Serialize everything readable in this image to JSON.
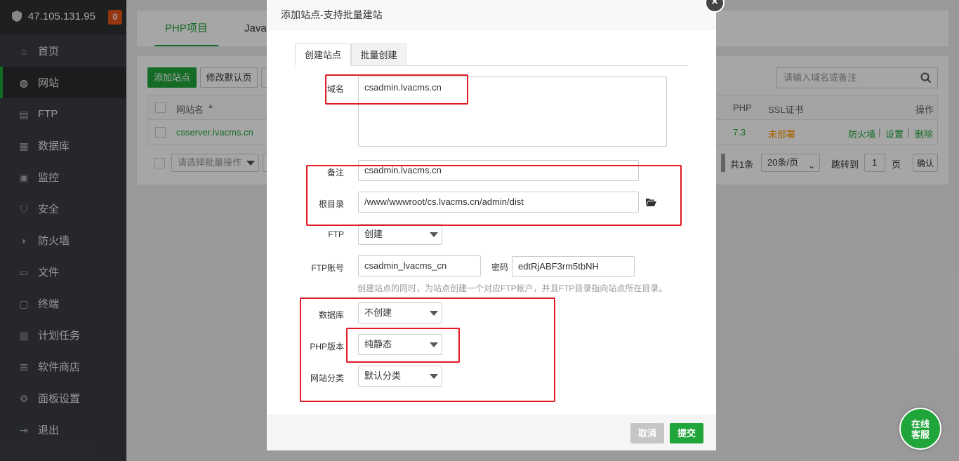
{
  "sidebar": {
    "ip": "47.105.131.95",
    "badge": "0",
    "items": [
      {
        "label": "首页",
        "icon": "home-icon"
      },
      {
        "label": "网站",
        "icon": "globe-icon"
      },
      {
        "label": "FTP",
        "icon": "ftp-icon"
      },
      {
        "label": "数据库",
        "icon": "database-icon"
      },
      {
        "label": "监控",
        "icon": "monitor-icon"
      },
      {
        "label": "安全",
        "icon": "shield-icon"
      },
      {
        "label": "防火墙",
        "icon": "firewall-icon"
      },
      {
        "label": "文件",
        "icon": "folder-icon"
      },
      {
        "label": "终端",
        "icon": "terminal-icon"
      },
      {
        "label": "计划任务",
        "icon": "calendar-icon"
      },
      {
        "label": "软件商店",
        "icon": "apps-icon"
      },
      {
        "label": "面板设置",
        "icon": "gear-icon"
      },
      {
        "label": "退出",
        "icon": "logout-icon"
      }
    ]
  },
  "page_tabs": [
    "PHP项目",
    "Java"
  ],
  "toolbar": {
    "add_site": "添加站点",
    "modify_default": "修改默认页",
    "search_placeholder": "请输入域名或备注"
  },
  "table": {
    "headers": {
      "name": "网站名",
      "php": "PHP",
      "ssl": "SSL证书",
      "ops": "操作"
    },
    "rows": [
      {
        "name": "csserver.lvacms.cn",
        "php": "7.3",
        "ssl": "未部署",
        "firewall": "防火墙",
        "settings": "设置",
        "delete": "删除"
      }
    ],
    "batch_placeholder": "请选择批量操作",
    "total": "共1条",
    "per_page": "20条/页",
    "goto": "跳转到",
    "page": "1",
    "page_unit": "页",
    "confirm": "确认"
  },
  "modal": {
    "title": "添加站点-支持批量建站",
    "tabs": [
      "创建站点",
      "批量创建"
    ],
    "domain_label": "域名",
    "domain_value": "csadmin.lvacms.cn",
    "remark_label": "备注",
    "remark_value": "csadmin.lvacms.cn",
    "root_label": "根目录",
    "root_value": "/www/wwwroot/cs.lvacms.cn/admin/dist",
    "ftp_label": "FTP",
    "ftp_value": "创建",
    "ftp_account_label": "FTP账号",
    "ftp_account_value": "csadmin_lvacms_cn",
    "password_label": "密码",
    "password_value": "edtRjABF3rm5tbNH",
    "ftp_hint": "创建站点的同时，为站点创建一个对应FTP帐户，并且FTP目录指向站点所在目录。",
    "db_label": "数据库",
    "db_value": "不创建",
    "php_label": "PHP版本",
    "php_value": "纯静态",
    "category_label": "网站分类",
    "category_value": "默认分类",
    "cancel": "取消",
    "submit": "提交"
  },
  "chat": {
    "line1": "在线",
    "line2": "客服"
  },
  "colors": {
    "accent": "#20a53a",
    "highlight": "#e01b24",
    "sidebar": "#3a3d42"
  }
}
